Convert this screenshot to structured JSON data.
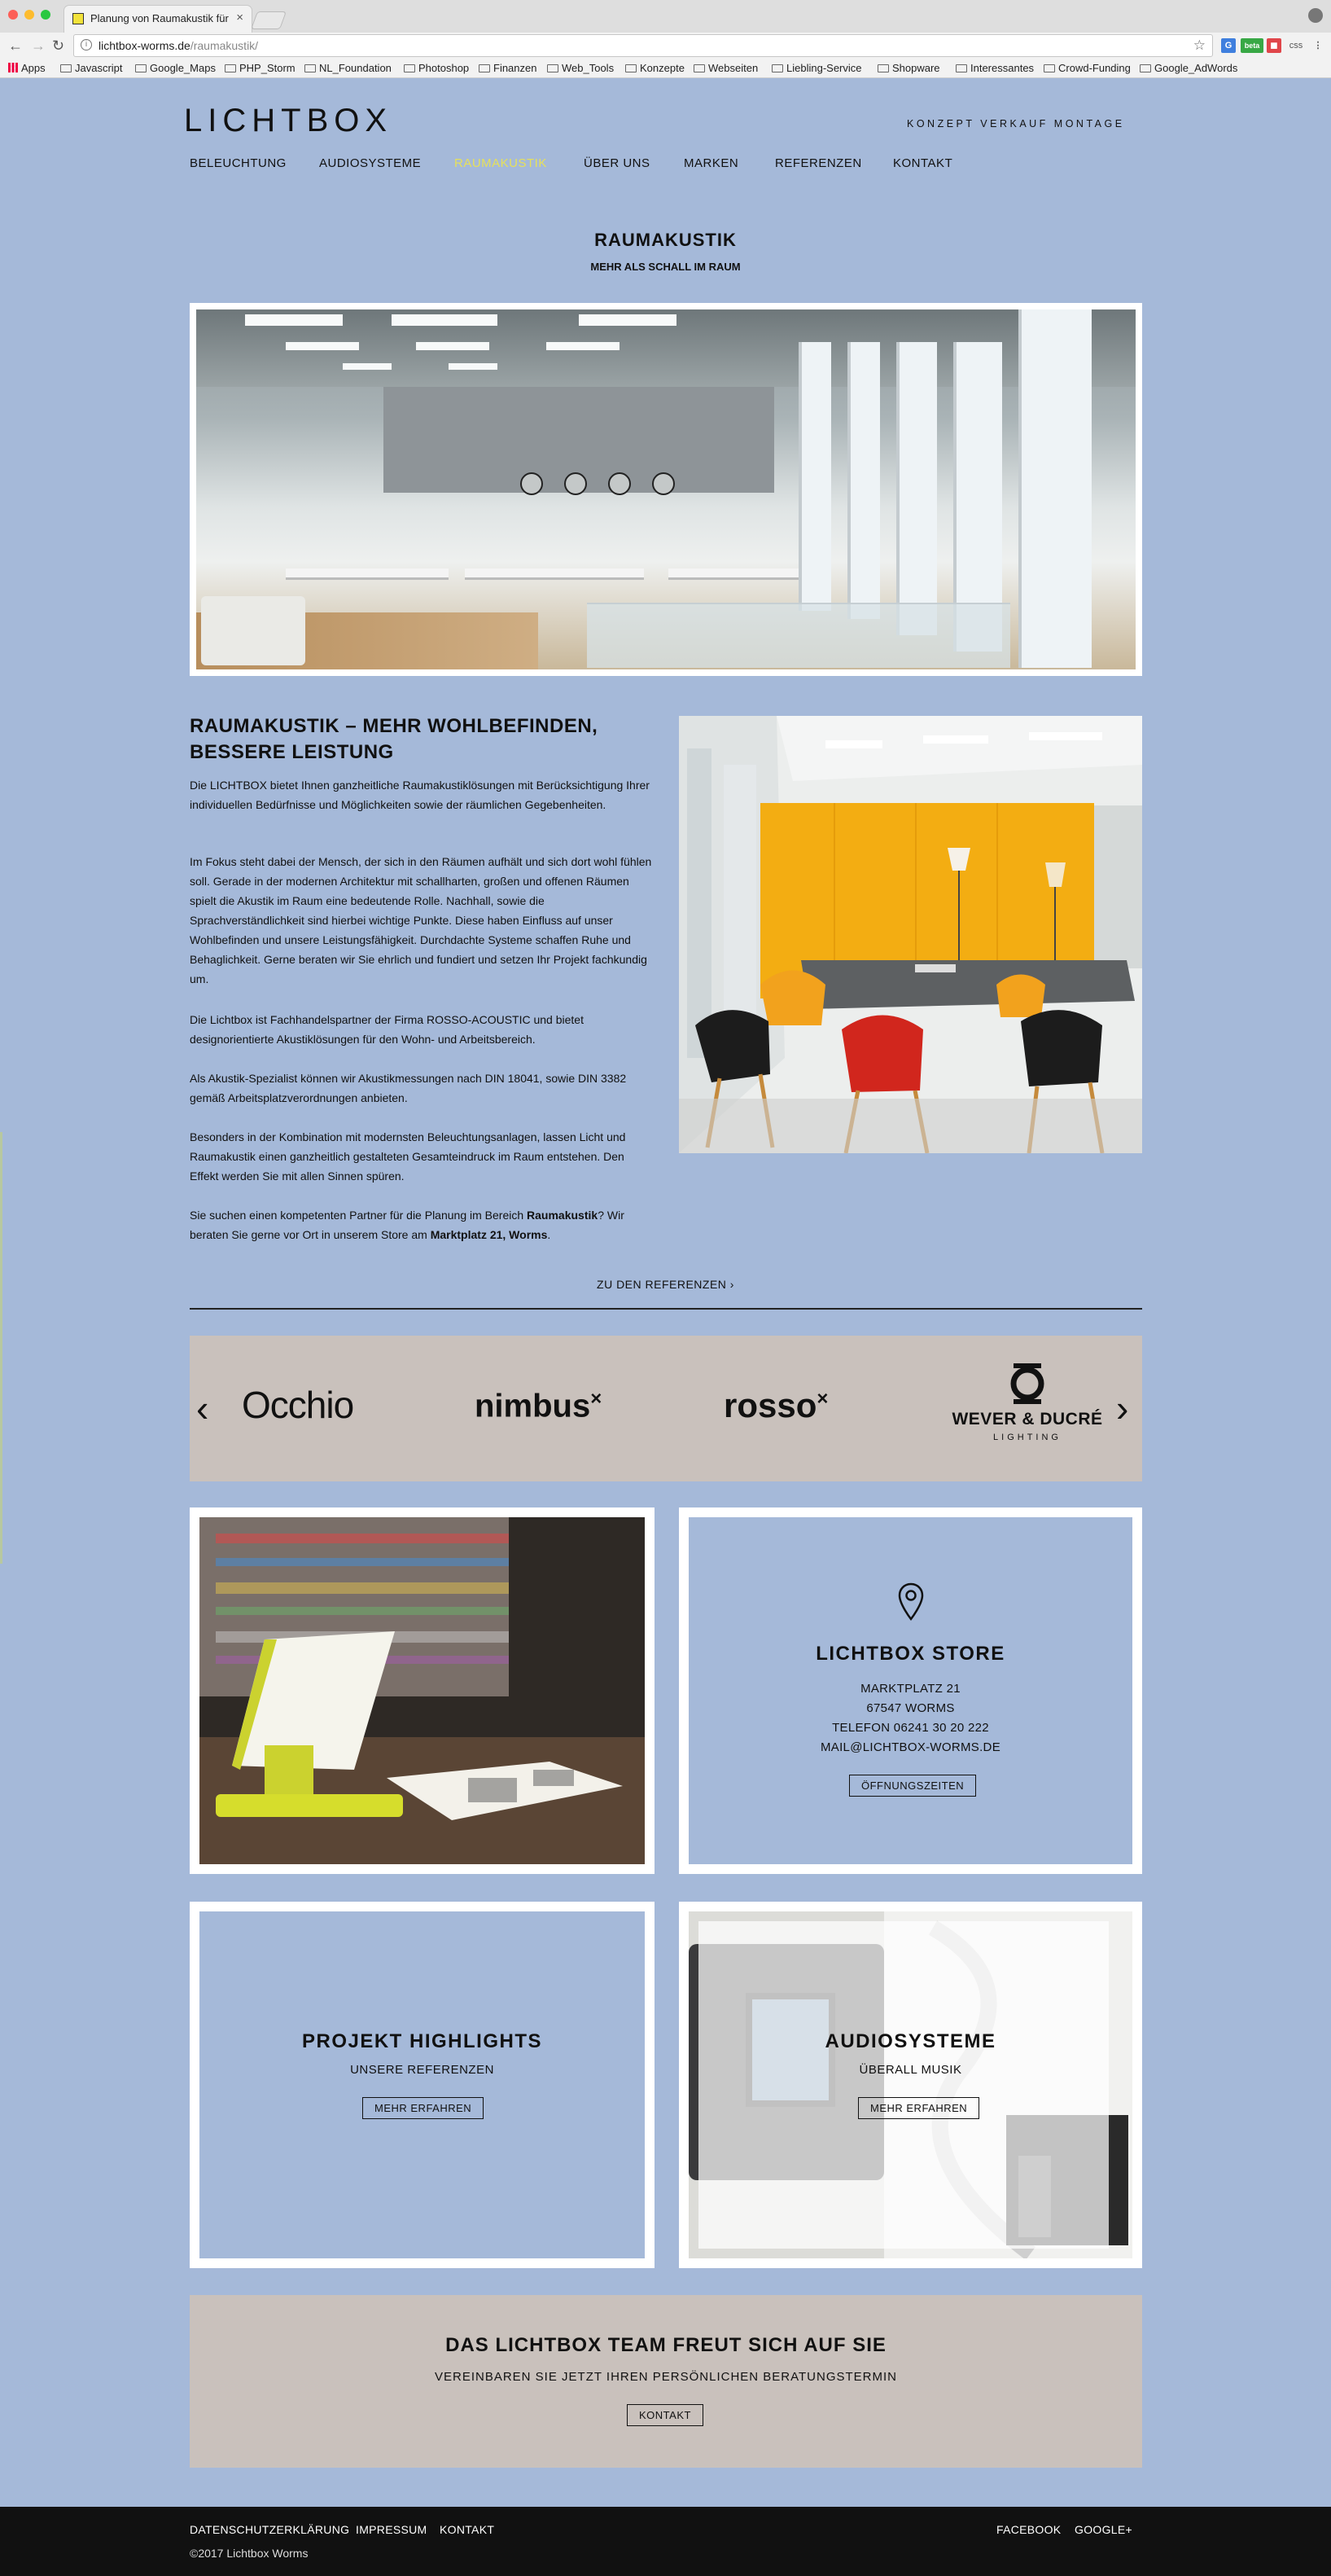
{
  "browser": {
    "tab_title": "Planung von Raumakustik für Wohn- und Arbeitsbereich",
    "url_domain": "lichtbox-worms.de",
    "url_path": "/raumakustik/",
    "extensions": [
      "beta",
      "css"
    ],
    "bookmarks": [
      "Apps",
      "Javascript",
      "Google_Maps",
      "PHP_Storm",
      "NL_Foundation",
      "Photoshop",
      "Finanzen",
      "Web_Tools",
      "Konzepte",
      "Webseiten",
      "Liebling-Service",
      "Shopware",
      "Interessantes",
      "Crowd-Funding",
      "Google_AdWords"
    ]
  },
  "header": {
    "logo": "LICHTBOX",
    "tagline": "KONZEPT  VERKAUF  MONTAGE",
    "nav": [
      "BELEUCHTUNG",
      "AUDIOSYSTEME",
      "RAUMAKUSTIK",
      "ÜBER UNS",
      "MARKEN",
      "REFERENZEN",
      "KONTAKT"
    ],
    "active_nav": "RAUMAKUSTIK",
    "active_color": "#e6e05b"
  },
  "page": {
    "title": "RAUMAKUSTIK",
    "subtitle": "MEHR ALS SCHALL IM RAUM"
  },
  "article": {
    "heading_line1": "RAUMAKUSTIK – MEHR WOHLBEFINDEN,",
    "heading_line2": "BESSERE LEISTUNG",
    "p1": "Die LICHTBOX bietet Ihnen ganzheitliche Raumakustiklösungen mit Berücksichtigung Ihrer individuellen Bedürfnisse und Möglichkeiten sowie der räumlichen Gegebenheiten.",
    "p2": "Im Fokus steht dabei der Mensch, der sich in den Räumen aufhält und sich dort wohl fühlen soll. Gerade in der modernen Architektur mit schallharten, großen und offenen Räumen spielt die Akustik im Raum eine bedeutende Rolle. Nachhall, sowie die Sprachverständlichkeit sind hierbei wichtige Punkte. Diese haben Einfluss auf unser Wohlbefinden und unsere Leistungsfähigkeit. Durchdachte Systeme schaffen Ruhe und Behaglichkeit. Gerne beraten wir Sie ehrlich und fundiert und setzen Ihr Projekt fachkundig um.",
    "p3": "Die Lichtbox ist Fachhandelspartner der Firma ROSSO-ACOUSTIC und bietet designorientierte Akustiklösungen für den Wohn- und Arbeitsbereich.",
    "p4": "Als Akustik-Spezialist können wir Akustikmessungen nach DIN 18041, sowie DIN 3382 gemäß Arbeitsplatzverordnungen anbieten.",
    "p5": "Besonders in der Kombination mit modernsten Beleuchtungsanlagen, lassen Licht und Raumakustik einen ganzheitlich gestalteten Gesamteindruck im Raum entstehen. Den Effekt werden Sie mit allen Sinnen spüren.",
    "p6_a": "Sie suchen einen kompetenten Partner für die Planung im Bereich ",
    "p6_b": "Raumakustik",
    "p6_c": "? Wir beraten Sie gerne vor Ort in unserem Store am ",
    "p6_d": "Marktplatz 21, Worms",
    "p6_e": ".",
    "refs_link": "ZU DEN REFERENZEN ›"
  },
  "brands": {
    "items": [
      "Occhio",
      "nimbus",
      "rosso",
      "WEVER & DUCRÉ"
    ],
    "wever_sub": "LIGHTING",
    "sup": "×",
    "prev": "‹",
    "next": "›"
  },
  "store": {
    "title": "LICHTBOX STORE",
    "street": "MARKTPLATZ 21",
    "city": "67547 WORMS",
    "phone": "TELEFON 06241 30 20 222",
    "email": "MAIL@LICHTBOX-WORMS.DE",
    "button": "ÖFFNUNGSZEITEN"
  },
  "tiles": {
    "projects_title": "PROJEKT HIGHLIGHTS",
    "projects_sub": "UNSERE REFERENZEN",
    "projects_button": "MEHR ERFAHREN",
    "audio_title": "AUDIOSYSTEME",
    "audio_sub": "ÜBERALL MUSIK",
    "audio_button": "MEHR ERFAHREN"
  },
  "cta": {
    "title": "DAS LICHTBOX TEAM FREUT SICH AUF SIE",
    "subtitle": "VEREINBAREN SIE JETZT IHREN PERSÖNLICHEN BERATUNGSTERMIN",
    "button": "KONTAKT"
  },
  "footer": {
    "links_left": [
      "DATENSCHUTZERKLÄRUNG",
      "IMPRESSUM",
      "KONTAKT"
    ],
    "links_right": [
      "FACEBOOK",
      "GOOGLE+"
    ],
    "copyright": "©2017 Lichtbox Worms"
  }
}
